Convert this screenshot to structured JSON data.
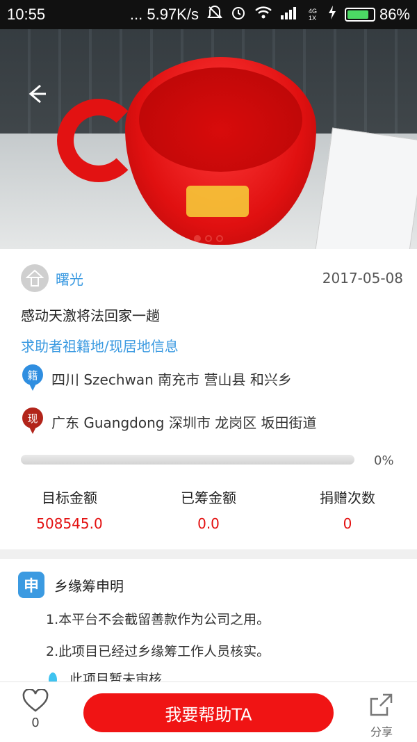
{
  "status_bar": {
    "time": "10:55",
    "network_speed": "... 5.97K/s",
    "signal_label": "4G 1X",
    "battery_percent": "86%",
    "battery_level": 0.86
  },
  "hero": {
    "slide_count": 3,
    "active_slide": 1
  },
  "project": {
    "author": "曙光",
    "date": "2017-05-08",
    "title": "感动天激将法回家一趟",
    "location_section": "求助者祖籍地/现居地信息",
    "origin_badge": "籍",
    "origin": "四川 Szechwan 南充市 营山县 和兴乡",
    "current_badge": "现",
    "current": "广东 Guangdong 深圳市 龙岗区 坂田街道",
    "progress_text": "0%",
    "progress_value": 0
  },
  "stats": {
    "target_label": "目标金额",
    "target_value": "508545.0",
    "raised_label": "已筹金额",
    "raised_value": "0.0",
    "donations_label": "捐赠次数",
    "donations_value": "0"
  },
  "statement": {
    "badge": "申",
    "title": "乡缘筹申明",
    "line1": "1.本平台不会截留善款作为公司之用。",
    "line2": "2.此项目已经过乡缘筹工作人员核实。",
    "line3": "此项目暂未审核"
  },
  "bottom": {
    "like_count": "0",
    "help_button": "我要帮助TA",
    "share_label": "分享"
  },
  "colors": {
    "accent_red": "#f01414",
    "link_blue": "#3b9ae1"
  }
}
